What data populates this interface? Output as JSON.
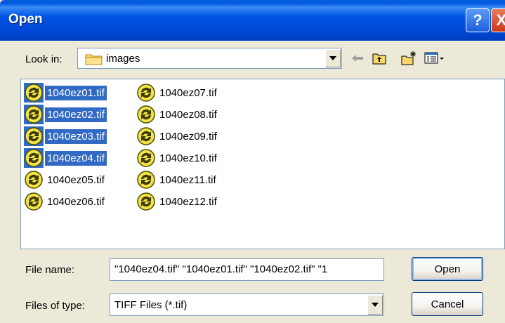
{
  "window": {
    "title": "Open",
    "help_glyph": "?",
    "close_glyph": "X"
  },
  "lookin": {
    "label": "Look in:",
    "value": "images",
    "icon": "folder-icon"
  },
  "toolbar": {
    "back_icon": "back-arrow-icon",
    "up_icon": "up-folder-icon",
    "new_folder_icon": "new-folder-icon",
    "view_menu_icon": "view-menu-icon"
  },
  "files": [
    {
      "name": "1040ez01.tif",
      "selected": true
    },
    {
      "name": "1040ez02.tif",
      "selected": true
    },
    {
      "name": "1040ez03.tif",
      "selected": true
    },
    {
      "name": "1040ez04.tif",
      "selected": true
    },
    {
      "name": "1040ez05.tif",
      "selected": false
    },
    {
      "name": "1040ez06.tif",
      "selected": false
    },
    {
      "name": "1040ez07.tif",
      "selected": false
    },
    {
      "name": "1040ez08.tif",
      "selected": false
    },
    {
      "name": "1040ez09.tif",
      "selected": false
    },
    {
      "name": "1040ez10.tif",
      "selected": false
    },
    {
      "name": "1040ez11.tif",
      "selected": false
    },
    {
      "name": "1040ez12.tif",
      "selected": false
    }
  ],
  "filename": {
    "label": "File name:",
    "value": "\"1040ez04.tif\" \"1040ez01.tif\" \"1040ez02.tif\" \"1"
  },
  "filetype": {
    "label": "Files of type:",
    "value": "TIFF Files (*.tif)"
  },
  "buttons": {
    "open": "Open",
    "cancel": "Cancel"
  },
  "colors": {
    "selection": "#316AC5",
    "titlebar": "#0054E3",
    "dialog_bg": "#ECE9D8"
  }
}
